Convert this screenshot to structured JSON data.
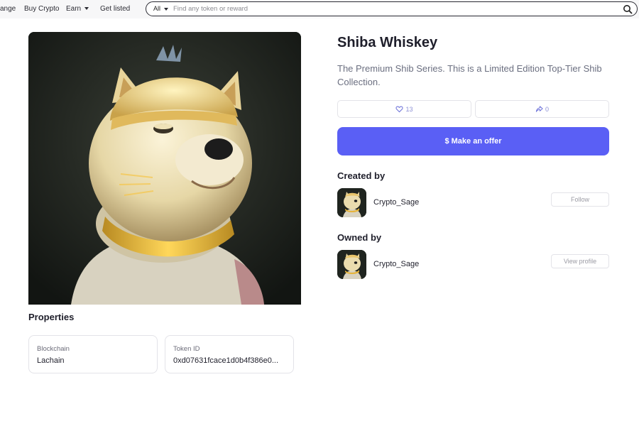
{
  "nav": {
    "items": [
      {
        "label": "ange",
        "caret": false
      },
      {
        "label": "Buy Crypto",
        "caret": false
      },
      {
        "label": "Earn",
        "caret": true
      },
      {
        "label": "Get listed",
        "caret": false
      }
    ],
    "search": {
      "filter_label": "All",
      "placeholder": "Find any token or reward",
      "icon": "search-icon"
    }
  },
  "nft": {
    "title": "Shiba Whiskey",
    "description": "The Premium Shib Series. This is a Limited Edition Top-Tier Shib Collection.",
    "likes": "13",
    "shares": "0",
    "offer_label": "$ Make an offer",
    "accent_color": "#5a5ff5"
  },
  "properties": {
    "title": "Properties",
    "items": [
      {
        "label": "Blockchain",
        "value": "Lachain"
      },
      {
        "label": "Token ID",
        "value": "0xd07631fcace1d0b4f386e0..."
      }
    ]
  },
  "created": {
    "title": "Created by",
    "name": "Crypto_Sage",
    "button_label": "Follow"
  },
  "owned": {
    "title": "Owned by",
    "name": "Crypto_Sage",
    "button_label": "View profile"
  }
}
